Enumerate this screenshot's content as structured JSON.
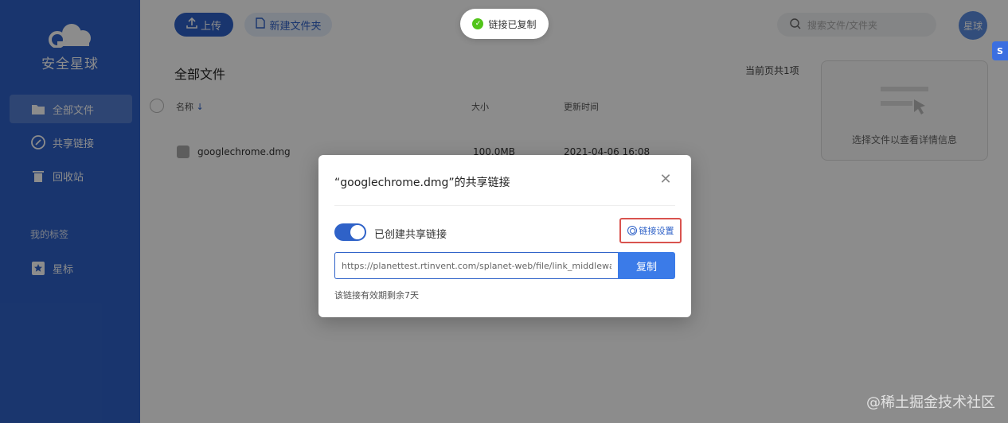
{
  "sidebar": {
    "app_title": "安全星球",
    "items": [
      {
        "label": "全部文件"
      },
      {
        "label": "共享链接"
      },
      {
        "label": "回收站"
      }
    ],
    "section_title": "我的标签",
    "tags": [
      {
        "label": "星标"
      }
    ]
  },
  "toolbar": {
    "upload_label": "上传",
    "new_folder_label": "新建文件夹",
    "search_placeholder": "搜索文件/文件夹",
    "avatar_text": "星球"
  },
  "content": {
    "heading": "全部文件",
    "page_count": "当前页共1项",
    "columns": {
      "name": "名称",
      "size": "大小",
      "time": "更新时间"
    },
    "files": [
      {
        "name": "googlechrome.dmg",
        "size": "100.0MB",
        "time": "2021-04-06 16:08"
      }
    ],
    "detail_hint": "选择文件以查看详情信息"
  },
  "toast": {
    "text": "链接已复制"
  },
  "floating_badge": "S",
  "modal": {
    "title": "“googlechrome.dmg”的共享链接",
    "toggle_label": "已创建共享链接",
    "toggle_on": true,
    "settings_label": "链接设置",
    "link_value": "https://planettest.rtinvent.com/splanet-web/file/link_middleware?linkTo",
    "copy_label": "复制",
    "expire_note": "该链接有效期剩余7天"
  },
  "watermark": "@稀土掘金技术社区",
  "colors": {
    "brand": "#2f62c8",
    "accent": "#3b7be8",
    "highlight_border": "#d9534f",
    "success": "#52c41a"
  }
}
